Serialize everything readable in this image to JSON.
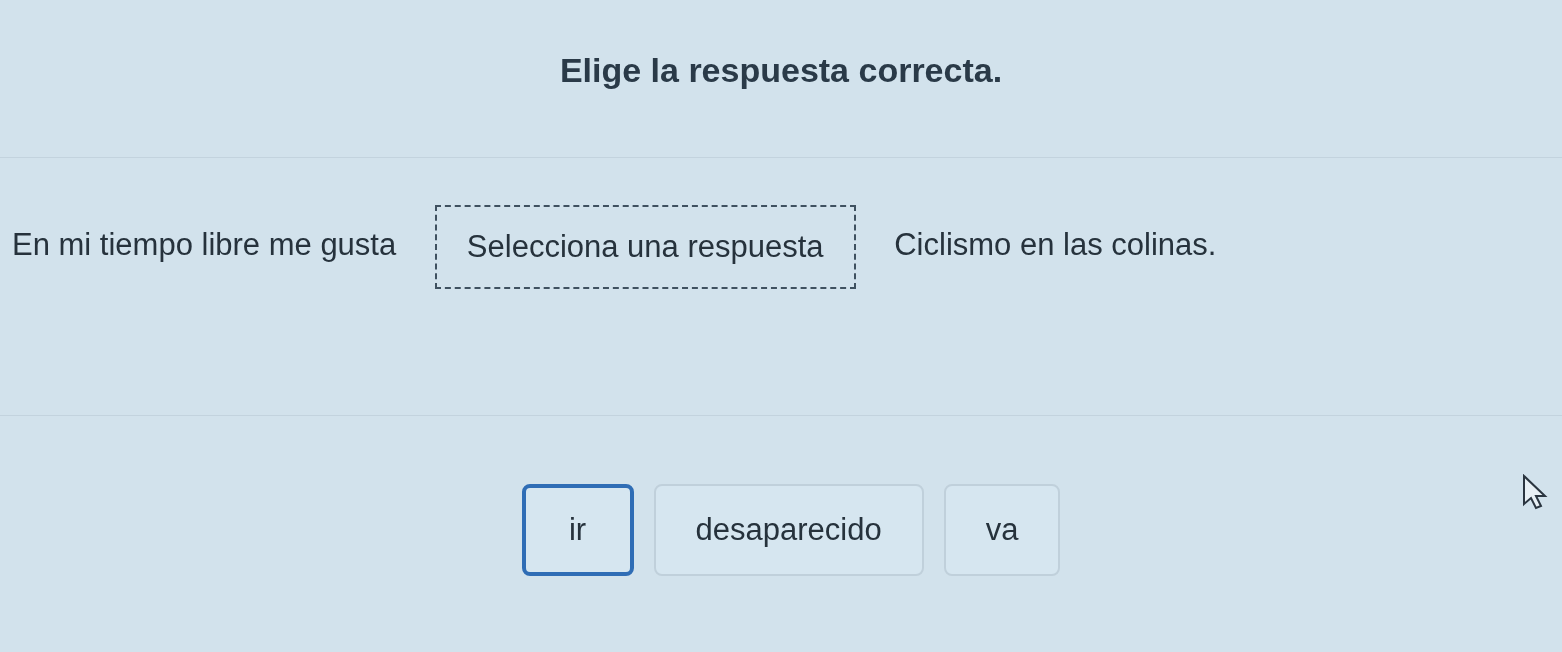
{
  "title": "Elige la respuesta correcta.",
  "sentence": {
    "before": "En mi tiempo libre me gusta",
    "blank": {
      "placeholder": "Selecciona una respuesta"
    },
    "after": "Ciclismo en las colinas."
  },
  "options": [
    {
      "label": "ir",
      "selected": true
    },
    {
      "label": "desaparecido",
      "selected": false
    },
    {
      "label": "va",
      "selected": false
    }
  ]
}
